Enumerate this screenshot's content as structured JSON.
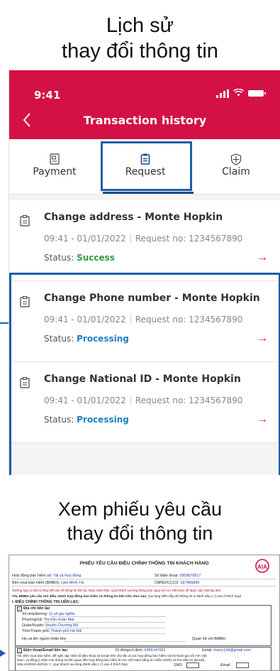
{
  "heading_top": {
    "line1": "Lịch sử",
    "line2": "thay đổi thông tin"
  },
  "heading_bottom": {
    "line1": "Xem phiếu yêu cầu",
    "line2": "thay đổi thông tin"
  },
  "status_bar": {
    "time": "9:41"
  },
  "nav": {
    "title": "Transaction history"
  },
  "tabs": [
    {
      "label": "Payment",
      "icon": "payment-doc-icon"
    },
    {
      "label": "Request",
      "icon": "clipboard-icon",
      "active": true
    },
    {
      "label": "Claim",
      "icon": "shield-plus-icon"
    }
  ],
  "transactions": [
    {
      "title": "Change address - Monte Hopkin",
      "time": "09:41 - 01/01/2022",
      "request": "Request no: 1234567890",
      "status_label": "Status:",
      "status": "Success",
      "status_color": "#2e9e3e"
    },
    {
      "title": "Change Phone number - Monte Hopkin",
      "time": "09:41 - 01/01/2022",
      "request": "Request no: 1234567890",
      "status_label": "Status:",
      "status": "Processing",
      "status_color": "#1c7fc2"
    },
    {
      "title": "Change National ID - Monte Hopkin",
      "time": "09:41 - 01/01/2022",
      "request": "Request no: 1234567890",
      "status_label": "Status:",
      "status": "Processing",
      "status_color": "#1c7fc2"
    }
  ],
  "colors": {
    "brand": "#d31145",
    "highlight": "#1f5fa8"
  },
  "form": {
    "title": "PHIẾU YÊU CẦU ĐIỀU CHỈNH THÔNG TIN KHÁCH HÀNG",
    "logo": "AIA",
    "contract_label": "Hợp đồng bảo hiểm số:",
    "contract_value": "Tất cả hợp đồng",
    "phone_label": "Số Điện thoại:",
    "phone_value": "0909678917",
    "buyer_label": "Bên mua bảo hiểm (BMBH):",
    "buyer_value": "Lâm Minh Tài",
    "id_label": "CMND/CCCD:",
    "id_value": "187466899",
    "notice": "Trường hợp có bất cứ thay đổi nào về thông tin liên lạc hoặc nhân thân, Quý khách vui lòng thông báo ngay với AIA Việt Nam để được cập nhật kịp thời.",
    "request_line": "Tôi, BMBH yêu cầu AIA điều chỉnh hợp đồng bảo hiểm có thông tin bên trên như sau:",
    "request_hint": "(vui lòng điền đầy đủ thông tin & đánh dấu (✓) vào ô thích hợp)",
    "section_title": "I.   ĐIỀU CHỈNH THÔNG TIN LIÊN LẠC:",
    "address_title": "Địa chỉ liên lạc",
    "street_label": "Số nhà/đường:",
    "street_value": "11 võ gia nghĩa",
    "ward_label": "Phường/Xã:",
    "ward_value": "Thị trấn Xuân Mai",
    "district_label": "Quận/Huyện:",
    "district_value": "Huyện Chương Mỹ",
    "city_label": "Tỉnh/Thành phố:",
    "city_value": "Thành phố Hà Nội",
    "receiver_label": "Họ và tên người nhận thư:",
    "relation_label": "Quan hệ với BMBH:",
    "contact_title": "Điện thoại/Email liên lạc:",
    "mobile_label": "Di động/cố định:",
    "mobile_value": "0356147691",
    "email_label": "Email:",
    "email_value": "tramy134@gmail.com",
    "consent_line1": "Tôi, Bên mua bảo hiểm, đề nghị cập nhật số điện thoại và Email trên cho tất cả các hợp đồng bảo hiểm mà tôi tham gia với AIA Việt",
    "consent_line2": "Nam, và đồng ý nhận mọi thông tin liên quan đến hợp đồng bảo hiểm từ AIA Việt Nam bằng tin nhắn (SMS) và thư điện tử (Email).",
    "refuse_line": "Nếu KHÔNG ĐỒNG Ý, Quý khách vui lòng đánh dấu (✓) vào ô thích hợp:",
    "sms_label": "SMS",
    "email_opt_label": "Email"
  }
}
